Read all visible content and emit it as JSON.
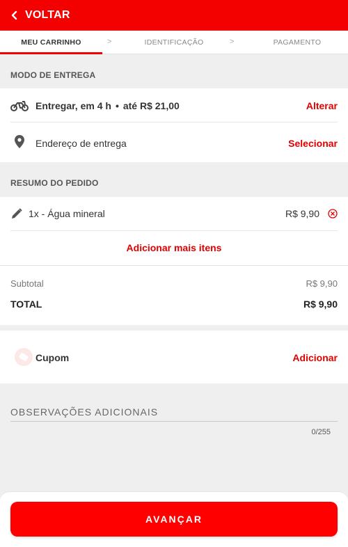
{
  "header": {
    "back_label": "VOLTAR"
  },
  "steps": [
    {
      "label": "MEU CARRINHO"
    },
    {
      "label": "IDENTIFICAÇÃO"
    },
    {
      "label": "PAGAMENTO"
    }
  ],
  "step_separator": ">",
  "delivery": {
    "section_title": "MODO DE ENTREGA",
    "mode_text": "Entregar, em 4 h",
    "bullet": "•",
    "price_text": "até R$ 21,00",
    "change_label": "Alterar",
    "address_text": "Endereço de entrega",
    "select_label": "Selecionar"
  },
  "order": {
    "section_title": "RESUMO DO PEDIDO",
    "items": [
      {
        "description": "1x - Água mineral",
        "price": "R$ 9,90"
      }
    ],
    "add_more_label": "Adicionar mais itens",
    "subtotal_label": "Subtotal",
    "subtotal_value": "R$ 9,90",
    "total_label": "TOTAL",
    "total_value": "R$ 9,90"
  },
  "coupon": {
    "label": "Cupom",
    "add_label": "Adicionar"
  },
  "notes": {
    "label": "OBSERVAÇÕES ADICIONAIS",
    "counter": "0/255"
  },
  "footer": {
    "next_label": "AVANÇAR"
  },
  "colors": {
    "brand_red": "#f30000",
    "action_red": "#e10000"
  }
}
